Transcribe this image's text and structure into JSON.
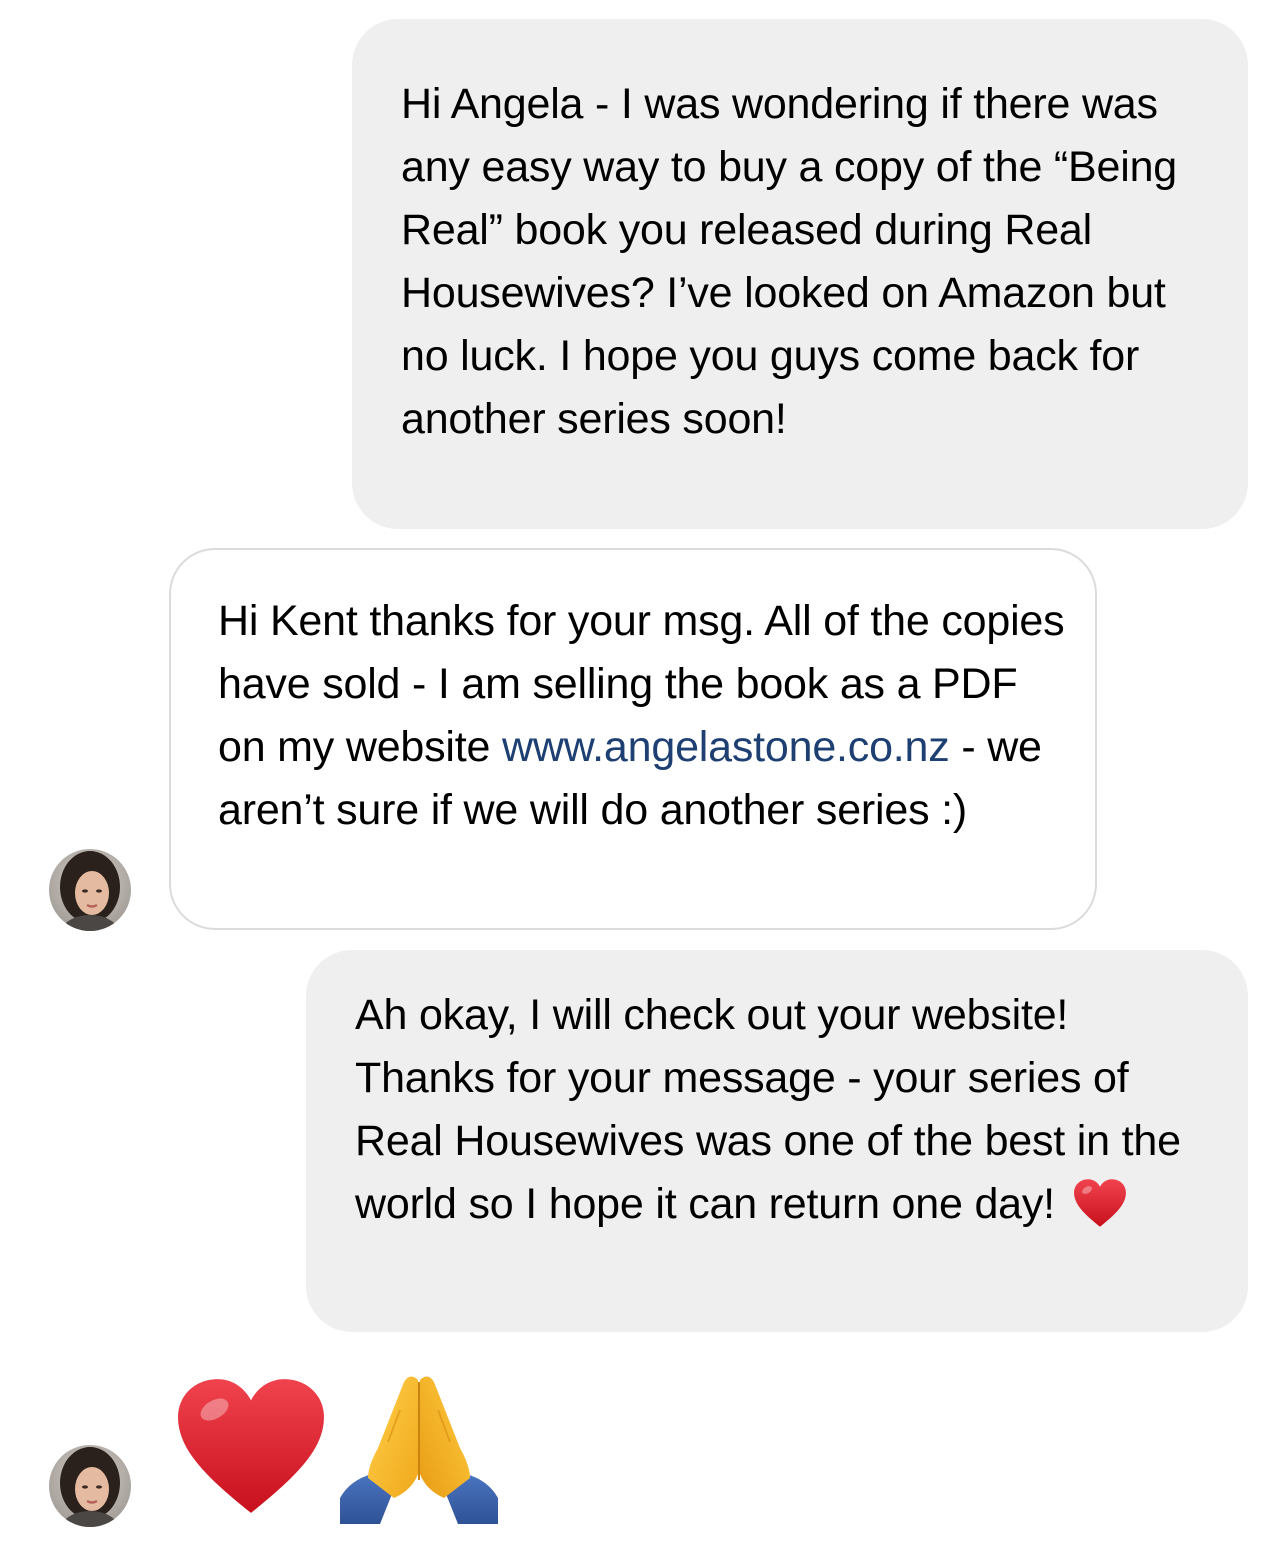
{
  "conversation": {
    "messages": [
      {
        "sender": "me",
        "text": "Hi Angela - I was wondering if there was any easy way to buy a copy of the “Being Real” book you released during Real Housewives? I’ve looked on Amazon but no luck. I hope you guys come back for another series soon!"
      },
      {
        "sender": "angela",
        "text_before_link": "Hi Kent thanks for your msg. All of the copies have sold - I am selling the book as a PDF on my website ",
        "link": "www.angelastone.co.nz",
        "text_after_link": " - we aren’t sure if we will do another series :)"
      },
      {
        "sender": "me",
        "text": "Ah okay, I will check out your website! Thanks for your message - your series of Real Housewives was one of the best in the world so I hope it can return one day! ",
        "trailing_icon": "red-heart-emoji"
      },
      {
        "sender": "angela",
        "icons": [
          "red-heart-emoji",
          "folded-hands-emoji"
        ]
      }
    ]
  },
  "colors": {
    "sent_bubble": "#efefef",
    "received_border": "#dbdbdb",
    "link": "#1d3f72",
    "heart": "#e8202e",
    "hands": "#f5b82a",
    "sleeve": "#3d64ad"
  }
}
